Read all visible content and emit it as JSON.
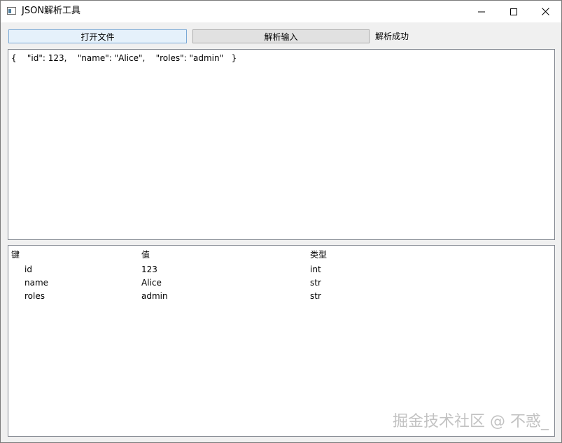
{
  "window": {
    "title": "JSON解析工具"
  },
  "toolbar": {
    "open_file_label": "打开文件",
    "parse_input_label": "解析输入",
    "status_text": "解析成功"
  },
  "editor": {
    "content": "{    \"id\": 123,    \"name\": \"Alice\",    \"roles\": \"admin\"   }"
  },
  "tree": {
    "headers": [
      "键",
      "值",
      "类型"
    ],
    "rows": [
      {
        "key": "id",
        "value": "123",
        "type": "int"
      },
      {
        "key": "name",
        "value": "Alice",
        "type": "str"
      },
      {
        "key": "roles",
        "value": "admin",
        "type": "str"
      }
    ]
  },
  "watermark": {
    "text": "掘金技术社区 @ 不惑_"
  },
  "icons": {
    "app": "app-window-icon",
    "minimize": "minimize-icon",
    "maximize": "maximize-icon",
    "close": "close-icon"
  }
}
